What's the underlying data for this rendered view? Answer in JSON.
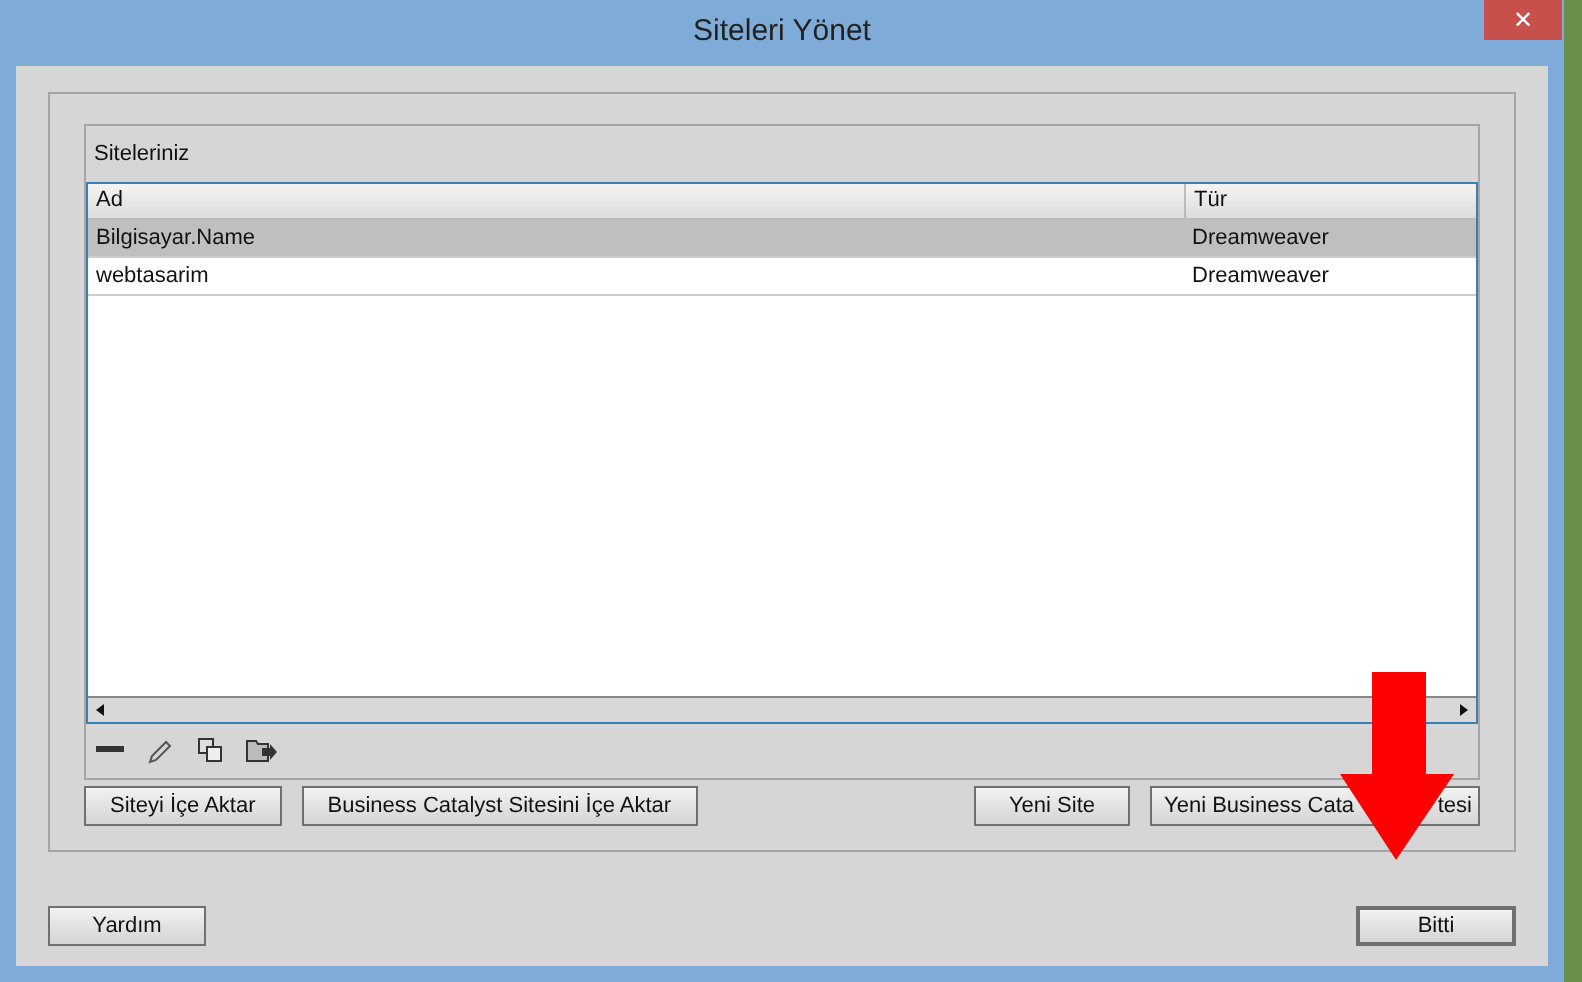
{
  "window": {
    "title": "Siteleri Yönet",
    "close_label": "✕"
  },
  "panel": {
    "title": "Siteleriniz"
  },
  "table": {
    "columns": [
      "Ad",
      "Tür"
    ],
    "rows": [
      {
        "cells": [
          "Bilgisayar.Name",
          "Dreamweaver"
        ],
        "selected": true
      },
      {
        "cells": [
          "webtasarim",
          "Dreamweaver"
        ],
        "selected": false
      }
    ]
  },
  "toolbar": [
    {
      "kind": "remove"
    },
    {
      "kind": "edit"
    },
    {
      "kind": "duplicate"
    },
    {
      "kind": "export"
    }
  ],
  "left_buttons": [
    {
      "label": "Siteyi İçe Aktar"
    },
    {
      "label": "Business Catalyst Sitesini İçe Aktar"
    }
  ],
  "right_buttons": [
    {
      "label_parts": [
        "Yeni Site"
      ]
    },
    {
      "label_parts": [
        "Yeni Business Cata",
        "tesi"
      ]
    }
  ],
  "footer": {
    "help": "Yardım",
    "done": "Bitti"
  }
}
